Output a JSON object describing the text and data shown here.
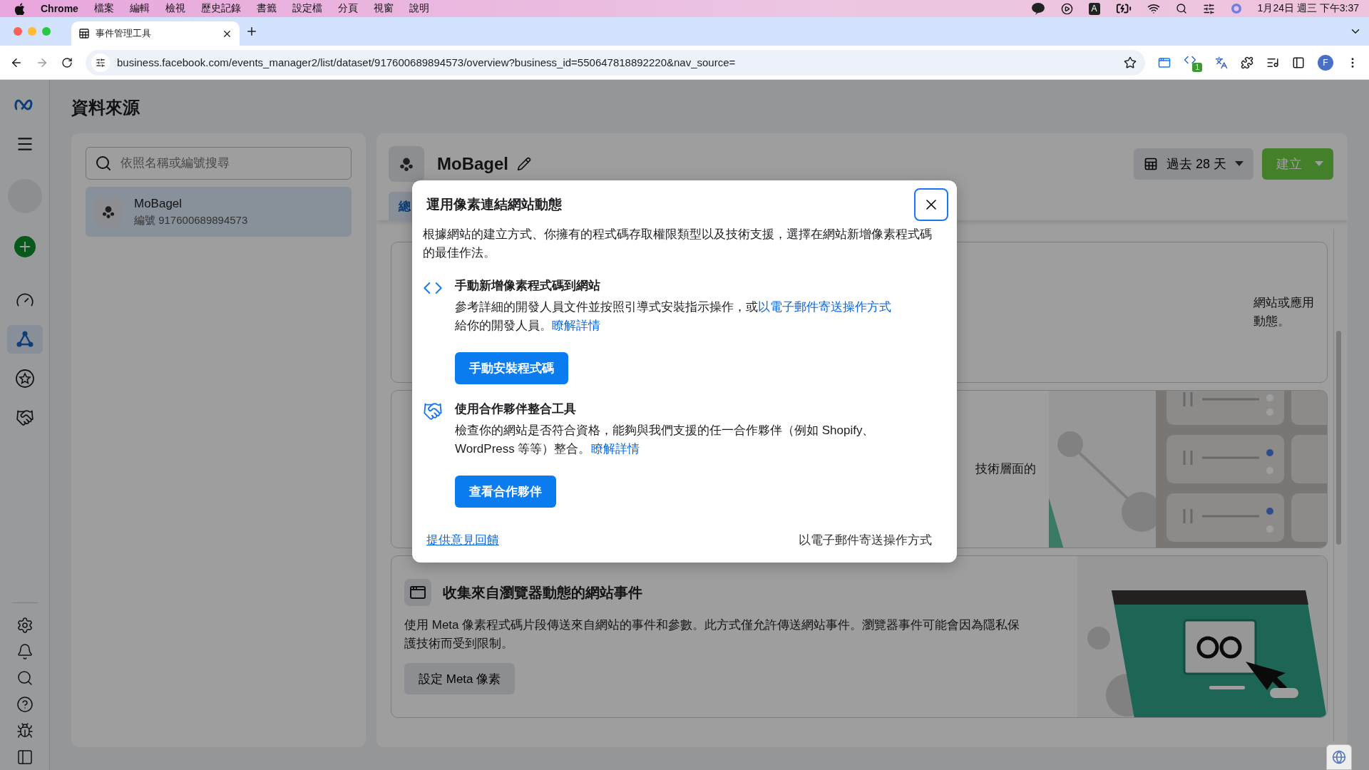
{
  "menu_bar": {
    "app_name": "Chrome",
    "menus": [
      "檔案",
      "編輯",
      "檢視",
      "歷史記錄",
      "書籤",
      "設定檔",
      "分頁",
      "視窗",
      "說明"
    ],
    "input_source": "A",
    "clock": "1月24日 週三 下午3:37"
  },
  "browser": {
    "tab_title": "事件管理工具",
    "url": "business.facebook.com/events_manager2/list/dataset/917600689894573/overview?business_id=550647818892220&nav_source=",
    "extension_badge": "1",
    "profile_initial": "F"
  },
  "nav": {
    "top": [
      {
        "kind": "gauge",
        "selected": false
      },
      {
        "kind": "network",
        "selected": true
      },
      {
        "kind": "star",
        "selected": false
      },
      {
        "kind": "handshake",
        "selected": false
      }
    ],
    "bottom": [
      {
        "kind": "settings"
      },
      {
        "kind": "bell"
      },
      {
        "kind": "search"
      },
      {
        "kind": "help"
      },
      {
        "kind": "bug"
      },
      {
        "kind": "panel"
      }
    ]
  },
  "page_title": "資料來源",
  "sources": {
    "search_placeholder": "依照名稱或編號搜尋",
    "items": [
      {
        "name": "MoBagel",
        "id": "編號 917600689894573",
        "selected": true
      }
    ]
  },
  "dataset": {
    "name": "MoBagel",
    "date_range": "過去 28 天",
    "create_label": "建立",
    "tabs": [
      {
        "label": "總",
        "selected": true
      }
    ],
    "cards": [
      {
        "kind": "fragment",
        "lines": [
          "網站或應用",
          "動態。"
        ]
      },
      {
        "kind": "fragment",
        "lines": [
          "技術層面的"
        ],
        "illustration": {
          "kind": "servers"
        }
      },
      {
        "kind": "full",
        "title": "收集來自瀏覽器動態的網站事件",
        "lines": [
          "使用 Meta 像素程式碼片段傳送來自網站的事件和參數。此方式僅允許傳送網站事件。瀏覽器事件可能會因為隱私保",
          "護技術而受到限制。"
        ],
        "button": "設定 Meta 像素",
        "illustration": {
          "kind": "browser"
        }
      }
    ]
  },
  "modal": {
    "title": "運用像素連結網站動態",
    "description_lines": [
      "根據網站的建立方式、你擁有的程式碼存取權限類型以及技術支援，選擇在網站新增像素程式碼",
      "的最佳作法。"
    ],
    "options": [
      {
        "kind": "code",
        "title": "手動新增像素程式碼到網站",
        "lines": [
          [
            {
              "text": "參考詳細的開發人員文件並按照引導式安裝指示操作，或"
            },
            {
              "link": "以電子郵件寄送操作方式"
            }
          ],
          [
            {
              "text": "給你的開發人員。"
            },
            {
              "link": "瞭解詳情"
            }
          ]
        ],
        "button": "手動安裝程式碼"
      },
      {
        "kind": "partner",
        "title": "使用合作夥伴整合工具",
        "lines": [
          [
            {
              "text": "檢查你的網站是否符合資格，能夠與我們支援的任一合作夥伴（例如 Shopify、"
            }
          ],
          [
            {
              "text": "WordPress 等等）整合。"
            },
            {
              "link": "瞭解詳情"
            }
          ]
        ],
        "button": "查看合作夥伴"
      }
    ],
    "feedback_link": "提供意見回饋",
    "email_action": "以電子郵件寄送操作方式"
  }
}
